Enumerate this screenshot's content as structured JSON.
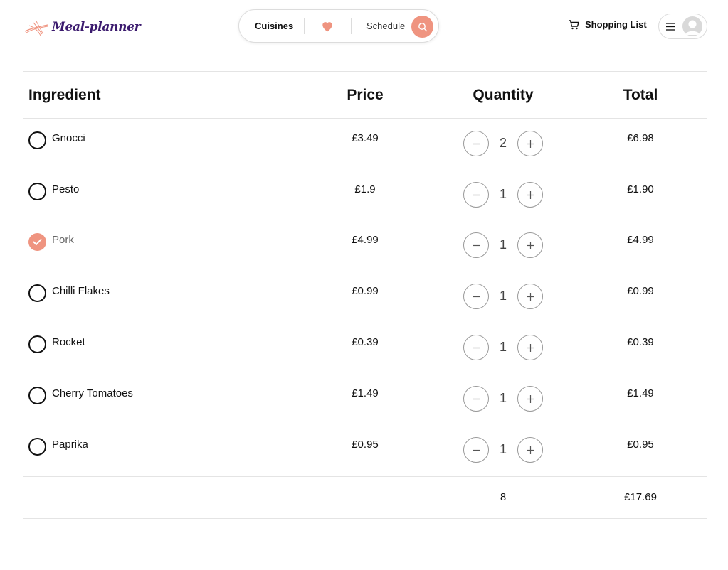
{
  "header": {
    "logo_text": "Meal-planner",
    "nav": {
      "cuisines_label": "Cuisines",
      "favorites_icon": "heart-icon",
      "schedule_label": "Schedule",
      "search_icon": "search-icon"
    },
    "shopping_list_label": "Shopping List",
    "menu_icon": "hamburger-icon",
    "avatar_icon": "user-avatar"
  },
  "table": {
    "headers": {
      "ingredient": "Ingredient",
      "price": "Price",
      "quantity": "Quantity",
      "total": "Total"
    },
    "rows": [
      {
        "name": "Gnocci",
        "price": "£3.49",
        "quantity": "2",
        "total": "£6.98",
        "checked": false
      },
      {
        "name": "Pesto",
        "price": "£1.9",
        "quantity": "1",
        "total": "£1.90",
        "checked": false
      },
      {
        "name": "Pork",
        "price": "£4.99",
        "quantity": "1",
        "total": "£4.99",
        "checked": true
      },
      {
        "name": "Chilli Flakes",
        "price": "£0.99",
        "quantity": "1",
        "total": "£0.99",
        "checked": false
      },
      {
        "name": "Rocket",
        "price": "£0.39",
        "quantity": "1",
        "total": "£0.39",
        "checked": false
      },
      {
        "name": "Cherry Tomatoes",
        "price": "£1.49",
        "quantity": "1",
        "total": "£1.49",
        "checked": false
      },
      {
        "name": "Paprika",
        "price": "£0.95",
        "quantity": "1",
        "total": "£0.95",
        "checked": false
      }
    ],
    "summary": {
      "quantity": "8",
      "total": "£17.69"
    }
  },
  "colors": {
    "accent": "#ef9480",
    "logo_text": "#3b1a6e",
    "border": "#e4e4e4"
  }
}
